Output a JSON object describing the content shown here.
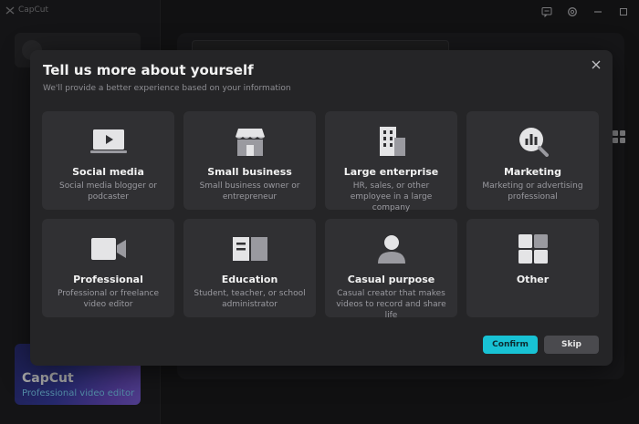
{
  "app": {
    "name": "CapCut",
    "logo_icon": "capcut-logo-icon"
  },
  "sidebar": {
    "promo_title": "CapCut",
    "promo_subtitle": "Professional video editor"
  },
  "modal": {
    "title": "Tell us more about yourself",
    "subtitle": "We'll provide a better experience based on your information",
    "close_icon": "close-icon",
    "options": [
      {
        "icon": "video-player-icon",
        "title": "Social media",
        "desc": "Social media blogger or podcaster"
      },
      {
        "icon": "storefront-icon",
        "title": "Small business",
        "desc": "Small business owner or entrepreneur"
      },
      {
        "icon": "office-building-icon",
        "title": "Large enterprise",
        "desc": "HR, sales, or other employee in a large company"
      },
      {
        "icon": "analytics-search-icon",
        "title": "Marketing",
        "desc": "Marketing or advertising professional"
      },
      {
        "icon": "video-camera-icon",
        "title": "Professional",
        "desc": "Professional or freelance video editor"
      },
      {
        "icon": "open-book-icon",
        "title": "Education",
        "desc": "Student, teacher, or school administrator"
      },
      {
        "icon": "person-icon",
        "title": "Casual purpose",
        "desc": "Casual creator that makes videos to record and share life"
      },
      {
        "icon": "grid-apps-icon",
        "title": "Other",
        "desc": ""
      }
    ],
    "confirm_label": "Confirm",
    "skip_label": "Skip"
  },
  "colors": {
    "accent": "#18c2d4",
    "modal_bg": "#252527",
    "card_bg": "#303033"
  }
}
